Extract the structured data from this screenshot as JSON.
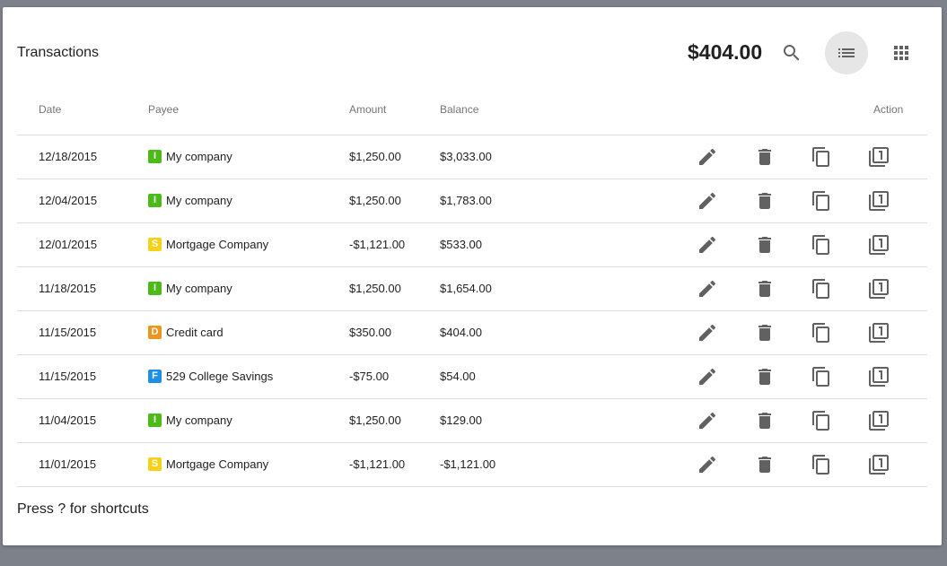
{
  "header": {
    "title": "Transactions",
    "balance": "$404.00"
  },
  "icons": {
    "search": "search-icon",
    "list_view": "list-view-icon",
    "grid_view": "grid-view-icon",
    "edit": "pencil-icon",
    "delete": "trash-icon",
    "copy": "copy-icon",
    "duplicate": "filter-1-icon"
  },
  "table": {
    "columns": {
      "date": "Date",
      "payee": "Payee",
      "amount": "Amount",
      "balance": "Balance",
      "action": "Action"
    },
    "rows": [
      {
        "date": "12/18/2015",
        "badge": "I",
        "badge_color": "#4cbb17",
        "payee": "My company",
        "amount": "$1,250.00",
        "balance": "$3,033.00"
      },
      {
        "date": "12/04/2015",
        "badge": "I",
        "badge_color": "#4cbb17",
        "payee": "My company",
        "amount": "$1,250.00",
        "balance": "$1,783.00"
      },
      {
        "date": "12/01/2015",
        "badge": "S",
        "badge_color": "#f7d117",
        "payee": "Mortgage Company",
        "amount": "-$1,121.00",
        "balance": "$533.00"
      },
      {
        "date": "11/18/2015",
        "badge": "I",
        "badge_color": "#4cbb17",
        "payee": "My company",
        "amount": "$1,250.00",
        "balance": "$1,654.00"
      },
      {
        "date": "11/15/2015",
        "badge": "D",
        "badge_color": "#f0951c",
        "payee": "Credit card",
        "amount": "$350.00",
        "balance": "$404.00"
      },
      {
        "date": "11/15/2015",
        "badge": "F",
        "badge_color": "#1e8fe6",
        "payee": "529 College Savings",
        "amount": "-$75.00",
        "balance": "$54.00"
      },
      {
        "date": "11/04/2015",
        "badge": "I",
        "badge_color": "#4cbb17",
        "payee": "My company",
        "amount": "$1,250.00",
        "balance": "$129.00"
      },
      {
        "date": "11/01/2015",
        "badge": "S",
        "badge_color": "#f7d117",
        "payee": "Mortgage Company",
        "amount": "-$1,121.00",
        "balance": "-$1,121.00"
      }
    ]
  },
  "footer": {
    "hint": "Press ? for shortcuts"
  }
}
